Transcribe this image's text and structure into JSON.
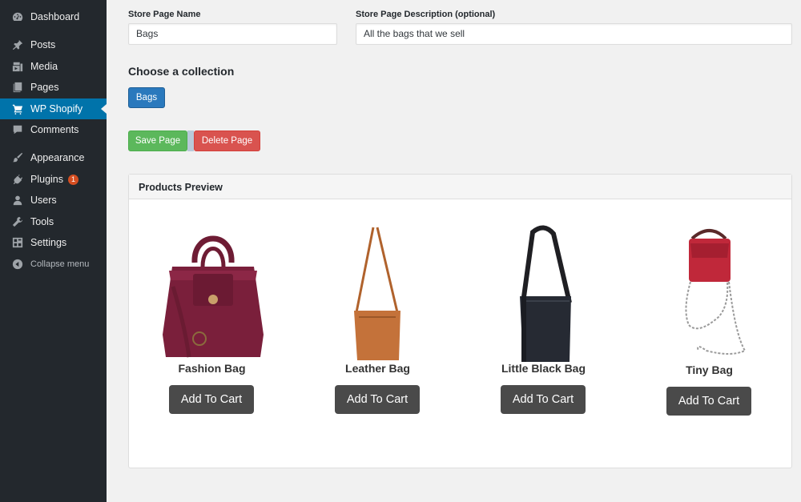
{
  "sidebar": {
    "items": [
      {
        "label": "Dashboard",
        "icon": "dashboard-icon"
      },
      {
        "label": "Posts",
        "icon": "pin-icon"
      },
      {
        "label": "Media",
        "icon": "media-icon"
      },
      {
        "label": "Pages",
        "icon": "pages-icon"
      },
      {
        "label": "WP Shopify",
        "icon": "cart-icon",
        "active": true
      },
      {
        "label": "Comments",
        "icon": "comment-icon"
      },
      {
        "label": "Appearance",
        "icon": "brush-icon"
      },
      {
        "label": "Plugins",
        "icon": "plug-icon",
        "badge": "1"
      },
      {
        "label": "Users",
        "icon": "user-icon"
      },
      {
        "label": "Tools",
        "icon": "wrench-icon"
      },
      {
        "label": "Settings",
        "icon": "settings-icon"
      },
      {
        "label": "Collapse menu",
        "icon": "collapse-icon"
      }
    ]
  },
  "form": {
    "name_label": "Store Page Name",
    "name_value": "Bags",
    "desc_label": "Store Page Description (optional)",
    "desc_value": "All the bags that we sell",
    "collection_heading": "Choose a collection",
    "collection_button": "Bags",
    "save_label": "Save Page",
    "delete_label": "Delete Page"
  },
  "preview": {
    "title": "Products Preview",
    "products": [
      {
        "name": "Fashion Bag",
        "cta": "Add To Cart"
      },
      {
        "name": "Leather Bag",
        "cta": "Add To Cart"
      },
      {
        "name": "Little Black Bag",
        "cta": "Add To Cart"
      },
      {
        "name": "Tiny Bag",
        "cta": "Add To Cart"
      }
    ]
  },
  "colors": {
    "sidebar": "#23282d",
    "active": "#0073aa",
    "blue_button": "#2a79bd",
    "save_button": "#5cb85c",
    "delete_button": "#d9534f",
    "cart_button": "#4a4a4a",
    "badge": "#d54e21"
  }
}
